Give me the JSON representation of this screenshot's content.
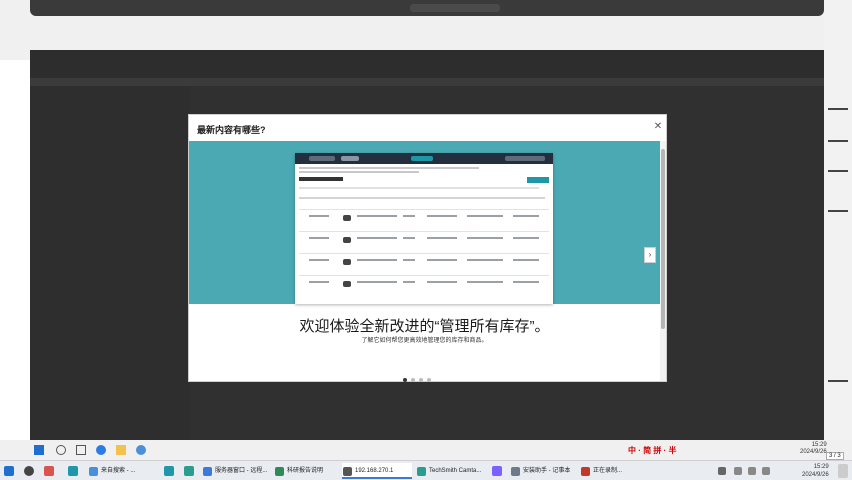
{
  "modal": {
    "title": "最新内容有哪些?",
    "close": "✕",
    "next": "›",
    "headline": "欢迎体验全新改进的“管理所有库存”。",
    "subline": "了解它如何帮您更高效地管理您的库存和商品。"
  },
  "secondary_bar": {
    "ime_label": "中 · 简 拼 · 半",
    "date": "2024/9/26",
    "time": "15:29",
    "page_indicator": "3 / 3"
  },
  "taskbar": {
    "items": [
      {
        "label": "来自搜索 - ...",
        "color": "#4a90d9"
      },
      {
        "label": "服务器窗口 - 远程...",
        "color": "#3a7bd5"
      },
      {
        "label": "科研报告说明",
        "color": "#2e8b57"
      },
      {
        "label": "192.168.270.1",
        "color": "#555555"
      },
      {
        "label": "TechSmith Camta...",
        "color": "#2a9d8f"
      },
      {
        "label": "安装助手 - 记事本",
        "color": "#6c7a89"
      },
      {
        "label": "正在录制...",
        "color": "#c0392b"
      }
    ],
    "clock_time": "15:29",
    "clock_date": "2024/9/26"
  },
  "colors": {
    "hero_bg": "#4aa9b3",
    "accent": "#1e97a8",
    "taskbar": "#e9ecf1"
  }
}
